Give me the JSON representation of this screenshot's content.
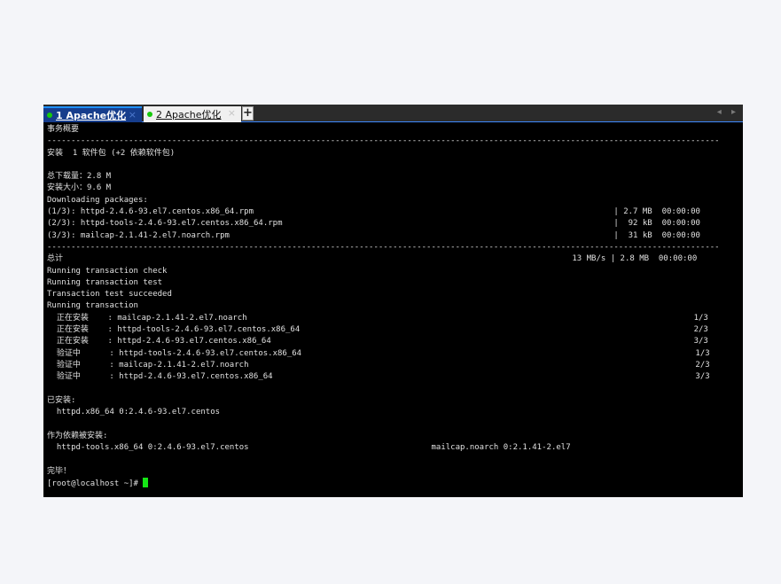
{
  "tabs": [
    {
      "label": "1 Apache优化",
      "close": "×",
      "active": true,
      "status_color": "#16c90c"
    },
    {
      "label": "2 Apache优化",
      "close": "×",
      "active": false,
      "status_color": "#16c90c"
    }
  ],
  "tab_add_label": "+",
  "tab_nav_label": "◂ ▸",
  "accent_color": "#1e90ff",
  "cursor_color": "#15e515",
  "terminal": {
    "lines": [
      "事务概要",
      "--------------------------------------------------------------------------------------------------------------------------------------------",
      "安装  1 软件包 (+2 依赖软件包)",
      "",
      "总下载量：2.8 M",
      "安装大小：9.6 M",
      "Downloading packages:",
      "(1/3): httpd-2.4.6-93.el7.centos.x86_64.rpm                                                                           | 2.7 MB  00:00:00",
      "(2/3): httpd-tools-2.4.6-93.el7.centos.x86_64.rpm                                                                     |  92 kB  00:00:00",
      "(3/3): mailcap-2.1.41-2.el7.noarch.rpm                                                                                |  31 kB  00:00:00",
      "--------------------------------------------------------------------------------------------------------------------------------------------",
      "总计                                                                                                          13 MB/s | 2.8 MB  00:00:00",
      "Running transaction check",
      "Running transaction test",
      "Transaction test succeeded",
      "Running transaction",
      "  正在安装    : mailcap-2.1.41-2.el7.noarch                                                                                             1/3",
      "  正在安装    : httpd-tools-2.4.6-93.el7.centos.x86_64                                                                                  2/3",
      "  正在安装    : httpd-2.4.6-93.el7.centos.x86_64                                                                                        3/3",
      "  验证中      : httpd-tools-2.4.6-93.el7.centos.x86_64                                                                                  1/3",
      "  验证中      : mailcap-2.1.41-2.el7.noarch                                                                                             2/3",
      "  验证中      : httpd-2.4.6-93.el7.centos.x86_64                                                                                        3/3",
      "",
      "已安装:",
      "  httpd.x86_64 0:2.4.6-93.el7.centos",
      "",
      "作为依赖被安装:",
      "  httpd-tools.x86_64 0:2.4.6-93.el7.centos                                      mailcap.noarch 0:2.1.41-2.el7",
      "",
      "完毕！"
    ],
    "prompt": "[root@localhost ~]# "
  }
}
